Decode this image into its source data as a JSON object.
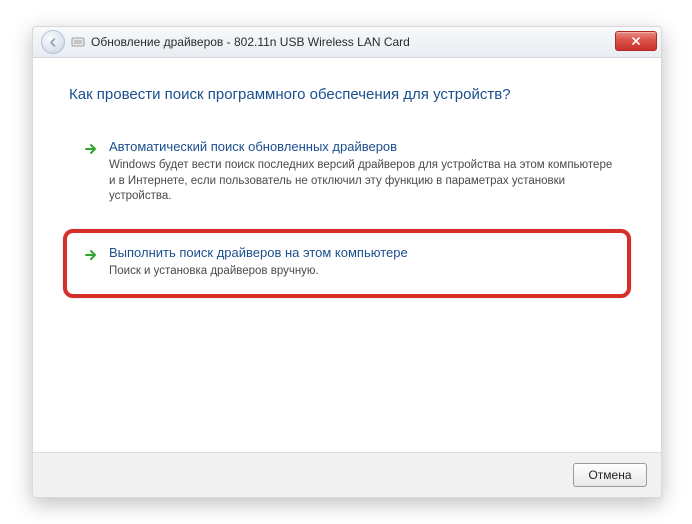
{
  "titlebar": {
    "title": "Обновление драйверов - 802.11n USB Wireless LAN Card"
  },
  "heading": "Как провести поиск программного обеспечения для устройств?",
  "options": {
    "auto": {
      "title": "Автоматический поиск обновленных драйверов",
      "desc": "Windows будет вести поиск последних версий драйверов для устройства на этом компьютере и в Интернете, если пользователь не отключил эту функцию в параметрах установки устройства."
    },
    "manual": {
      "title": "Выполнить поиск драйверов на этом компьютере",
      "desc": "Поиск и установка драйверов вручную."
    }
  },
  "footer": {
    "cancel": "Отмена"
  }
}
